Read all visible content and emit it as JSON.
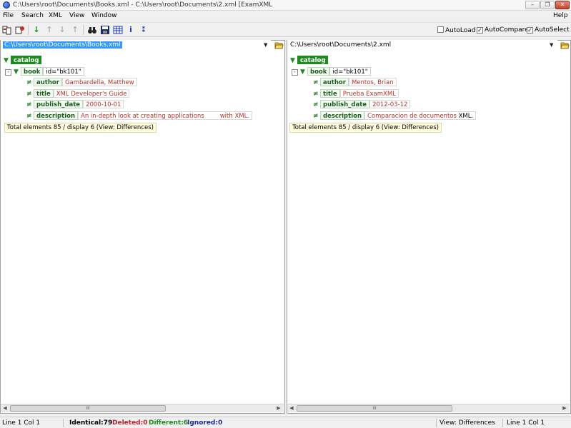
{
  "window": {
    "title": "C:\\Users\\root\\Documents\\Books.xml - C:\\Users\\root\\Documents\\2.xml [ExamXML",
    "minimize": "–",
    "restore": "❐",
    "close": "✕"
  },
  "menu": {
    "file": "File",
    "search": "Search",
    "xml": "XML",
    "view": "View",
    "window": "Window",
    "help": "Help"
  },
  "toolbar": {
    "icons": [
      "compare-files-icon",
      "options-icon",
      "next-difference-icon",
      "previous-difference-icon",
      "last-difference-icon",
      "first-difference-icon",
      "find-icon",
      "save-icon",
      "grid-icon",
      "info-icon",
      "sort-icon"
    ],
    "autoload_label": "AutoLoad",
    "autoload_checked": false,
    "autocompare_label": "AutoCompare",
    "autocompare_checked": true,
    "autoselect_label": "AutoSelect",
    "autoselect_checked": true
  },
  "left": {
    "path": "C:\\Users\\root\\Documents\\Books.xml",
    "root_tag": "catalog",
    "book_tag": "book",
    "book_attr": "id=\"bk101\"",
    "nodes": [
      {
        "tag": "author",
        "value": "Gambardella, Matthew",
        "tail": ""
      },
      {
        "tag": "title",
        "value": "XML Developer's Guide",
        "tail": ""
      },
      {
        "tag": "publish_date",
        "value": "2000-10-01",
        "tail": ""
      },
      {
        "tag": "description",
        "value": "An in-depth look at creating applications",
        "tail": "with XML."
      }
    ],
    "info": "Total elements 85 / display 6 (View: Differences)"
  },
  "right": {
    "path": "C:\\Users\\root\\Documents\\2.xml",
    "root_tag": "catalog",
    "book_tag": "book",
    "book_attr": "id=\"bk101\"",
    "nodes": [
      {
        "tag": "author",
        "value": "Mentos, Brian",
        "tail": ""
      },
      {
        "tag": "title",
        "value": "Prueba ExamXML",
        "tail": ""
      },
      {
        "tag": "publish_date",
        "value": "2012-03-12",
        "tail": ""
      },
      {
        "tag": "description",
        "value": "Comparacion de documentos",
        "tail": "XML."
      }
    ],
    "info": "Total elements 85 / display 6 (View: Differences)"
  },
  "scroll_thumb": "III",
  "status": {
    "left_pos": "Line 1  Col 1",
    "identical": "Identical:79",
    "deleted": "Deleted:0",
    "different": "Different:6",
    "ignored": "Ignored:0",
    "view": "View: Differences",
    "right_pos": "Line 1  Col 1",
    "colors": {
      "identical": "#000000",
      "deleted": "#c0202a",
      "different": "#1f8a1f",
      "ignored": "#1c2a9c"
    }
  }
}
